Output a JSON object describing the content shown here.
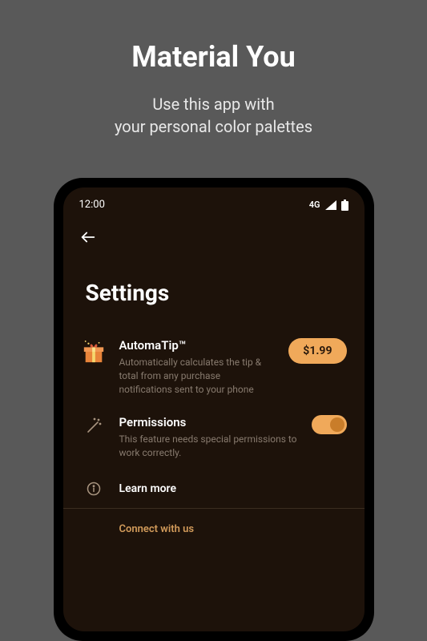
{
  "header": {
    "title": "Material You",
    "subtitle": "Use this app with\nyour personal color palettes"
  },
  "statusBar": {
    "time": "12:00",
    "network": "4G"
  },
  "screen": {
    "title": "Settings"
  },
  "settings": {
    "automatip": {
      "title": "AutomaTip™",
      "description": "Automatically calculates the tip & total from any purchase notifications sent to your phone",
      "price": "$1.99"
    },
    "permissions": {
      "title": "Permissions",
      "description": "This feature needs special permissions to work correctly."
    },
    "learnMore": "Learn more",
    "connect": "Connect with us"
  },
  "colors": {
    "accent": "#f0a95a"
  }
}
